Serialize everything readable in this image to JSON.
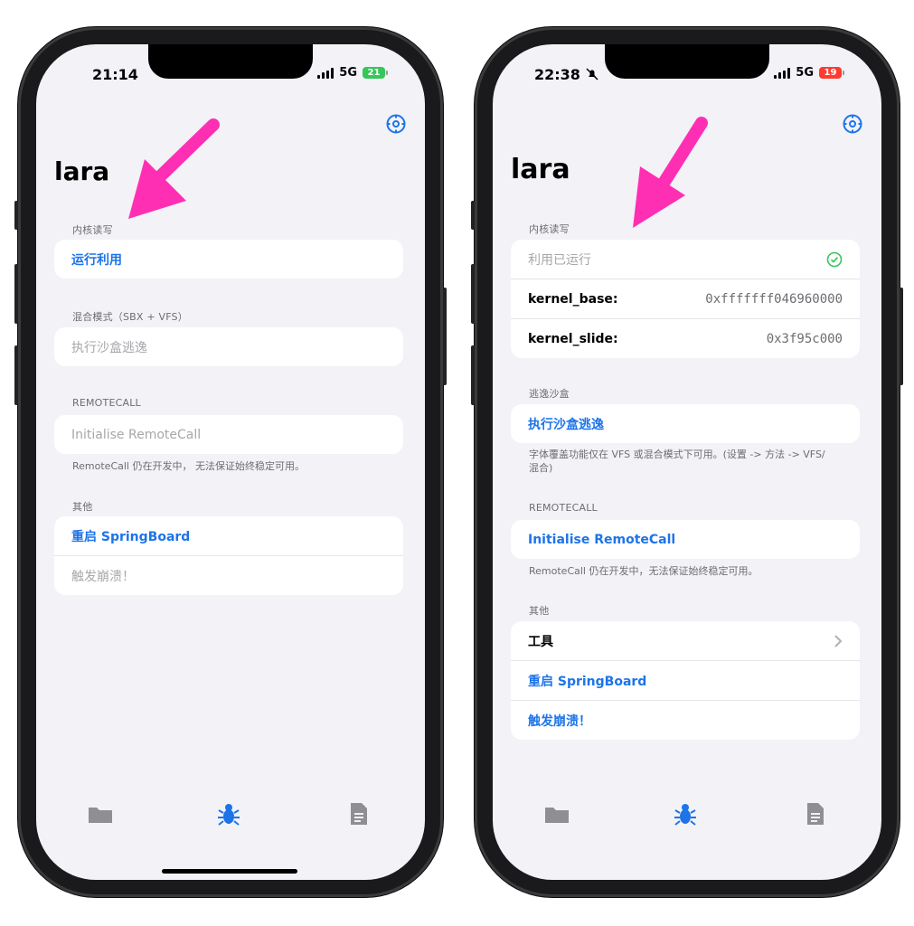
{
  "left": {
    "status": {
      "time": "21:14",
      "network": "5G",
      "battery": "21",
      "battery_color": "#34c759"
    },
    "app_title": "lara",
    "sections": {
      "kernel_rw": {
        "label": "内核读写",
        "run_exploit": "运行利用"
      },
      "hybrid": {
        "label": "混合模式（SBX + VFS）",
        "sandbox_escape": "执行沙盒逃逸"
      },
      "remotecall": {
        "label": "REMOTECALL",
        "init": "Initialise RemoteCall",
        "note": "RemoteCall 仍在开发中， 无法保证始终稳定可用。"
      },
      "other": {
        "label": "其他",
        "respring": "重启 SpringBoard",
        "crash": "触发崩溃！"
      }
    },
    "tabs": {
      "files": "folder-icon",
      "exploit": "bug-icon",
      "logs": "document-icon"
    }
  },
  "right": {
    "status": {
      "time": "22:38",
      "network": "5G",
      "battery": "19",
      "battery_color": "#ff3b30"
    },
    "app_title": "lara",
    "sections": {
      "kernel_rw": {
        "label": "内核读写",
        "exploit_ran": "利用已运行",
        "kernel_base_label": "kernel_base:",
        "kernel_base_value": "0xfffffff046960000",
        "kernel_slide_label": "kernel_slide:",
        "kernel_slide_value": "0x3f95c000"
      },
      "escape": {
        "label": "逃逸沙盒",
        "sandbox_escape": "执行沙盒逃逸",
        "note": "字体覆盖功能仅在 VFS 或混合模式下可用。(设置 -> 方法 -> VFS/混合)"
      },
      "remotecall": {
        "label": "REMOTECALL",
        "init": "Initialise RemoteCall",
        "note": "RemoteCall 仍在开发中，无法保证始终稳定可用。"
      },
      "other": {
        "label": "其他",
        "tools": "工具",
        "respring": "重启 SpringBoard",
        "crash": "触发崩溃！"
      }
    },
    "tabs": {
      "files": "folder-icon",
      "exploit": "bug-icon",
      "logs": "document-icon"
    }
  },
  "colors": {
    "accent": "#1d74e8",
    "arrow": "#ff2fb4",
    "success": "#34c759",
    "background": "#f2f2f7"
  }
}
